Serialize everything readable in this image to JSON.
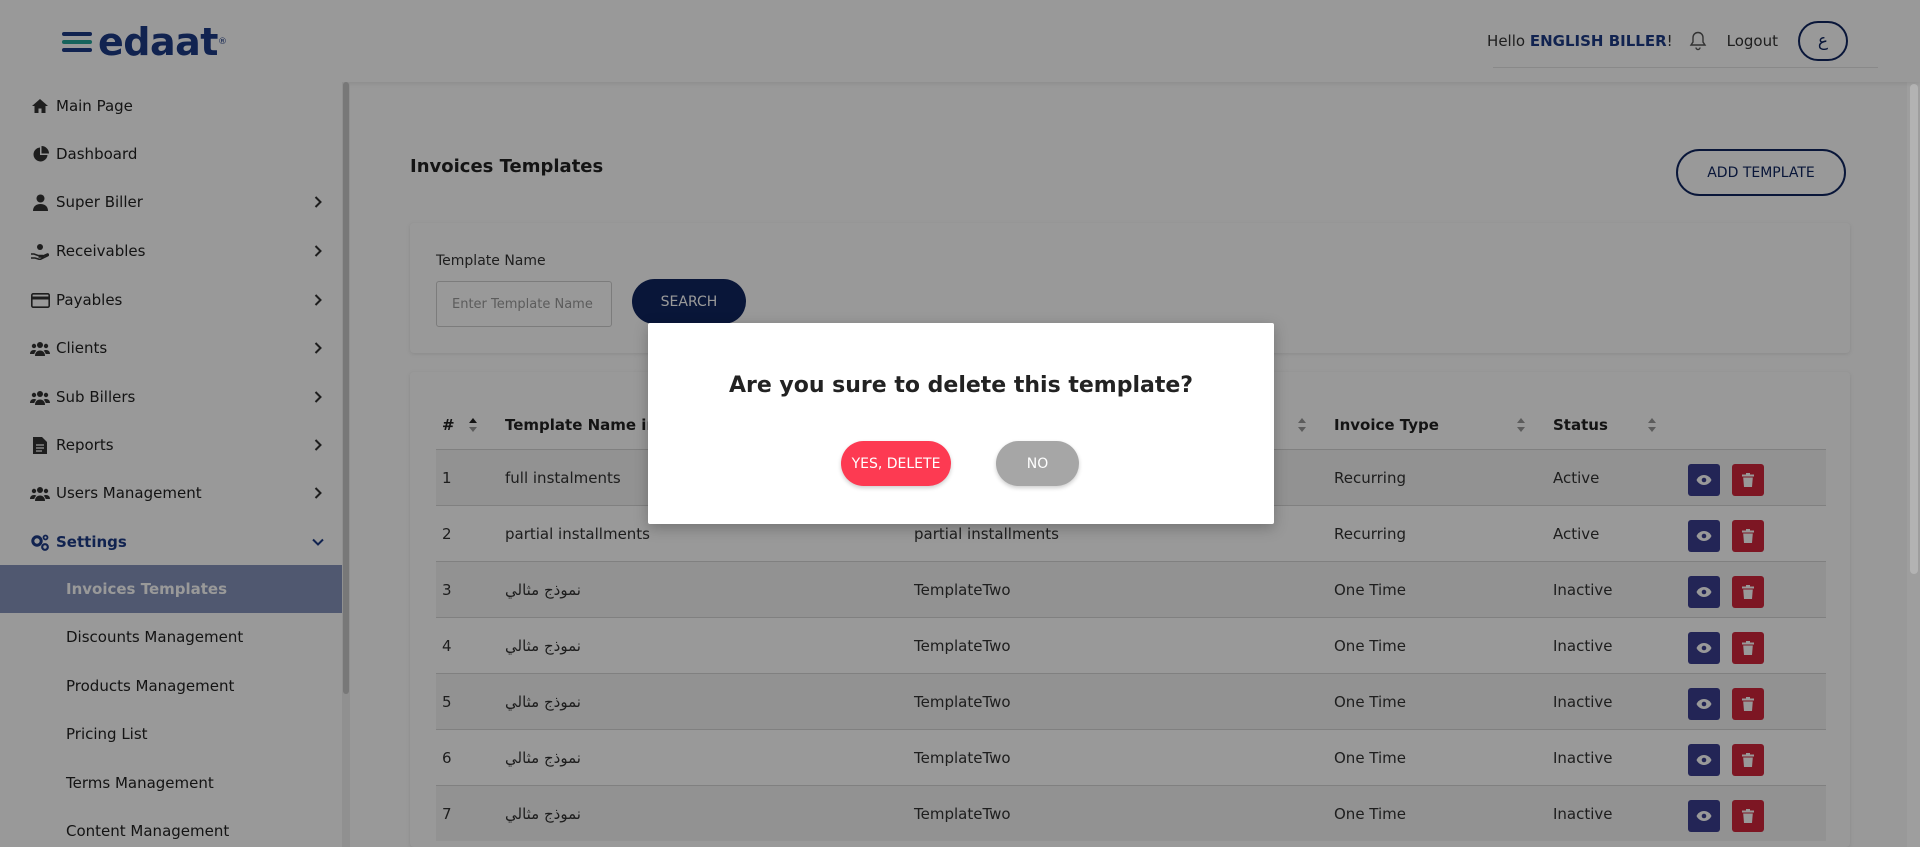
{
  "header": {
    "logo_text": "edaat",
    "logo_mark": "®",
    "hello_prefix": "Hello",
    "user_name": "ENGLISH BILLER",
    "hello_suffix": "!",
    "bell_icon": "bell-icon",
    "logout_label": "Logout",
    "language_toggle": "ع"
  },
  "sidebar": {
    "items": [
      {
        "label": "Main Page",
        "icon": "home-icon"
      },
      {
        "label": "Dashboard",
        "icon": "pie-chart-icon"
      },
      {
        "label": "Super Biller",
        "icon": "user-icon"
      },
      {
        "label": "Receivables",
        "icon": "hand-coin-icon"
      },
      {
        "label": "Payables",
        "icon": "credit-card-icon"
      },
      {
        "label": "Clients",
        "icon": "users-icon"
      },
      {
        "label": "Sub Billers",
        "icon": "users-icon"
      },
      {
        "label": "Reports",
        "icon": "file-icon"
      },
      {
        "label": "Users Management",
        "icon": "users-icon"
      },
      {
        "label": "Settings",
        "icon": "cogs-icon"
      }
    ],
    "settings_sub": [
      {
        "label": "Invoices Templates",
        "active": true
      },
      {
        "label": "Discounts Management"
      },
      {
        "label": "Products Management"
      },
      {
        "label": "Pricing List"
      },
      {
        "label": "Terms Management"
      },
      {
        "label": "Content Management"
      }
    ]
  },
  "main": {
    "page_title": "Invoices Templates",
    "add_button": "ADD TEMPLATE",
    "search": {
      "label": "Template Name",
      "placeholder": "Enter Template Name",
      "button": "SEARCH"
    },
    "table": {
      "headers": [
        "#",
        "Template Name in A",
        "Invoice Type",
        "Status"
      ],
      "rows": [
        {
          "num": "1",
          "name_ar": "full instalments",
          "name_en": "",
          "type": "Recurring",
          "status": "Active"
        },
        {
          "num": "2",
          "name_ar": "partial installments",
          "name_en": "partial installments",
          "type": "Recurring",
          "status": "Active"
        },
        {
          "num": "3",
          "name_ar": "نموذج مثالي",
          "name_en": "TemplateTwo",
          "type": "One Time",
          "status": "Inactive"
        },
        {
          "num": "4",
          "name_ar": "نموذج مثالي",
          "name_en": "TemplateTwo",
          "type": "One Time",
          "status": "Inactive"
        },
        {
          "num": "5",
          "name_ar": "نموذج مثالي",
          "name_en": "TemplateTwo",
          "type": "One Time",
          "status": "Inactive"
        },
        {
          "num": "6",
          "name_ar": "نموذج مثالي",
          "name_en": "TemplateTwo",
          "type": "One Time",
          "status": "Inactive"
        },
        {
          "num": "7",
          "name_ar": "نموذج مثالي",
          "name_en": "TemplateTwo",
          "type": "One Time",
          "status": "Inactive"
        }
      ]
    }
  },
  "modal": {
    "message": "Are you sure to delete this template?",
    "yes_label": "YES, DELETE",
    "no_label": "NO"
  },
  "colors": {
    "brand_navy": "#0f2560",
    "brand_blue": "#1d3b86",
    "danger": "#fd3a52",
    "view_button": "#3b3f8f",
    "delete_button": "#d1263b",
    "active_menu": "#8593bb"
  }
}
